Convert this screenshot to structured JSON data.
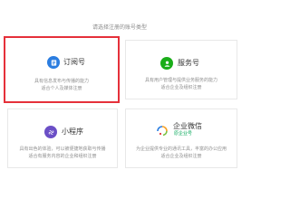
{
  "page": {
    "title": "请选择注册的账号类型"
  },
  "cards": {
    "subscription": {
      "name": "订阅号",
      "desc_line1": "具有信息发布与传播的能力",
      "desc_line2": "适合个人及媒体注册",
      "icon": "subscription-icon",
      "icon_color": "#2b7de0"
    },
    "service": {
      "name": "服务号",
      "desc_line1": "具有用户管理与提供业务服务的能力",
      "desc_line2": "适合企业及组织注册",
      "icon": "user-icon",
      "icon_color": "#1aad19"
    },
    "miniprogram": {
      "name": "小程序",
      "desc_line1": "具有出色的体验，可以被便捷地获取与传播",
      "desc_line2": "适合有服务内容的企业和组织注册",
      "icon": "miniprogram-icon",
      "icon_color": "#6b4fc6"
    },
    "wework": {
      "name": "企业微信",
      "sub": "原企业号",
      "desc_line1": "为企业提供专业的通讯工具，丰富的办公应用",
      "desc_line2": "适合企业及组织注册",
      "icon": "wework-icon",
      "icon_colors": [
        "#f7a023",
        "#2b7de0",
        "#7ac142",
        "#e5303a"
      ]
    }
  },
  "selection": {
    "selected_card": "subscription",
    "highlight_color": "#e5303a"
  }
}
